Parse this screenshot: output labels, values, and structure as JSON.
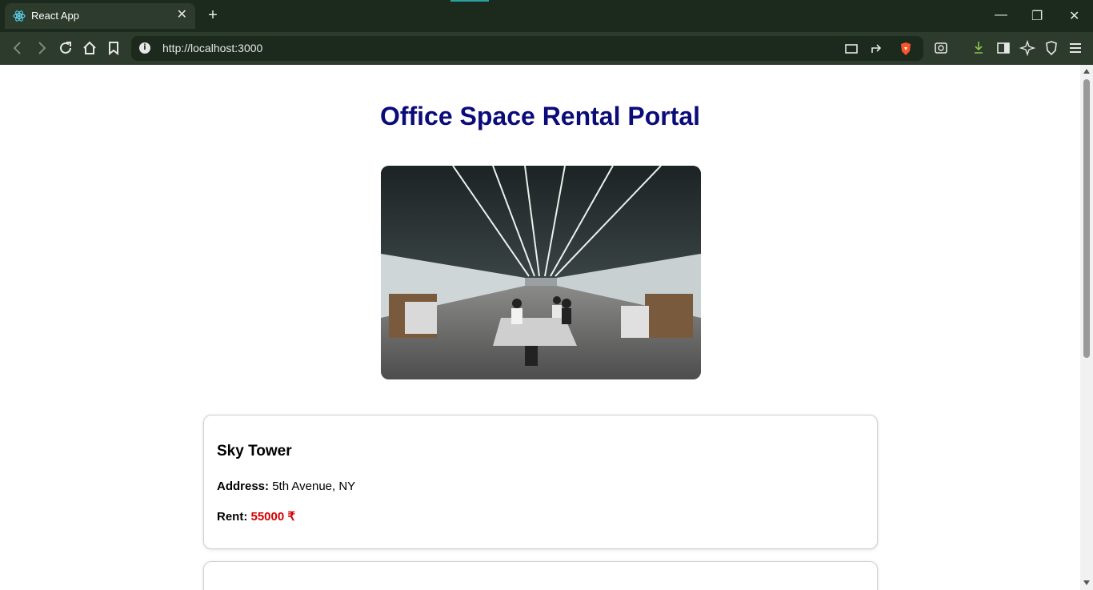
{
  "browser": {
    "tab_title": "React App",
    "url": "http://localhost:3000",
    "tab_close_glyph": "✕",
    "new_tab_glyph": "+",
    "window_minimize": "—",
    "window_restore": "❐",
    "window_close": "✕",
    "accent": "#2aa1a1"
  },
  "page": {
    "title": "Office Space Rental Portal",
    "title_color": "#0b0b7a",
    "hero_image": "office-interior"
  },
  "listings": [
    {
      "name": "Sky Tower",
      "address_label": "Address:",
      "address": "5th Avenue, NY",
      "rent_label": "Rent:",
      "rent": "55000 ₹",
      "rent_color": "#d40000"
    }
  ]
}
